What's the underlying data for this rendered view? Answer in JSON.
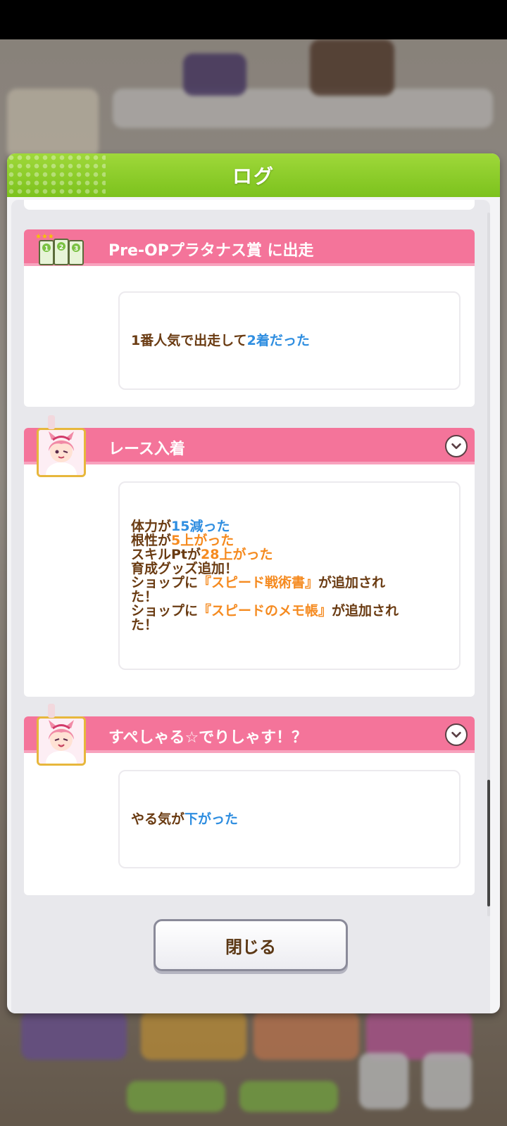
{
  "dialog": {
    "title": "ログ",
    "close_label": "閉じる"
  },
  "entries": [
    {
      "icon": "race-tickets-icon",
      "title": "Pre-OPプラタナス賞 に出走",
      "collapsible": false,
      "lines": [
        [
          {
            "text": "1番人気で出走して",
            "color": "brown"
          },
          {
            "text": "2着だった",
            "color": "blue"
          }
        ]
      ]
    },
    {
      "icon": "character-portrait",
      "title": "レース入着",
      "collapsible": true,
      "lines": [
        [
          {
            "text": "体力が",
            "color": "brown"
          },
          {
            "text": "15減った",
            "color": "blue"
          }
        ],
        [
          {
            "text": "根性が",
            "color": "brown"
          },
          {
            "text": "5上がった",
            "color": "orange"
          }
        ],
        [
          {
            "text": "スキルPtが",
            "color": "brown"
          },
          {
            "text": "28上がった",
            "color": "orange"
          }
        ],
        [
          {
            "text": "育成グッズ追加！",
            "color": "brown"
          }
        ],
        [
          {
            "text": "ショップに",
            "color": "brown"
          },
          {
            "text": "『スピード戦術書』",
            "color": "orange"
          },
          {
            "text": "が追加され",
            "color": "brown"
          }
        ],
        [
          {
            "text": "た！",
            "color": "brown"
          }
        ],
        [
          {
            "text": "ショップに",
            "color": "brown"
          },
          {
            "text": "『スピードのメモ帳』",
            "color": "orange"
          },
          {
            "text": "が追加され",
            "color": "brown"
          }
        ],
        [
          {
            "text": "た！",
            "color": "brown"
          }
        ]
      ]
    },
    {
      "icon": "character-portrait",
      "title": "すぺしゃる☆でりしゃす！？",
      "collapsible": true,
      "lines": [
        [
          {
            "text": "やる気が",
            "color": "brown"
          },
          {
            "text": "下がった",
            "color": "blue"
          }
        ]
      ]
    }
  ],
  "colors": {
    "header_green": "#8cce2a",
    "entry_pink": "#f4749a",
    "text_brown": "#6a3b12",
    "text_blue": "#2f8ee0",
    "text_orange": "#f58a1f"
  }
}
